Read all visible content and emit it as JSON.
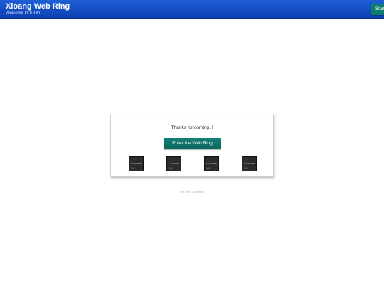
{
  "header": {
    "title": "Xloang Web Ring",
    "subtitle": "Welcome DDDDD",
    "start_label": "Start"
  },
  "card": {
    "message": "Thanks for coming .!",
    "enter_label": "Enter the Web Ring",
    "thumbnails": [
      {
        "lines": [
          "In aliquet et",
          "sagittis at ornare",
          "a. Ut eu sodales",
          ""
        ],
        "foot": "DDDD"
      },
      {
        "lines": [
          "In aliquet et",
          "sagittis at ornare",
          "a. Ut eu sodales",
          ""
        ],
        "foot": "DDDD"
      },
      {
        "lines": [
          "In aliquet et",
          "sagittis at ornare",
          "a. Ut eu sodales",
          ""
        ],
        "foot": "DDDD"
      },
      {
        "lines": [
          "In aliquet et",
          "sagittis at ornare",
          "a. Ut eu sodales",
          ""
        ],
        "foot": "DDDD"
      }
    ]
  },
  "footer": {
    "note": "thx for coming"
  }
}
